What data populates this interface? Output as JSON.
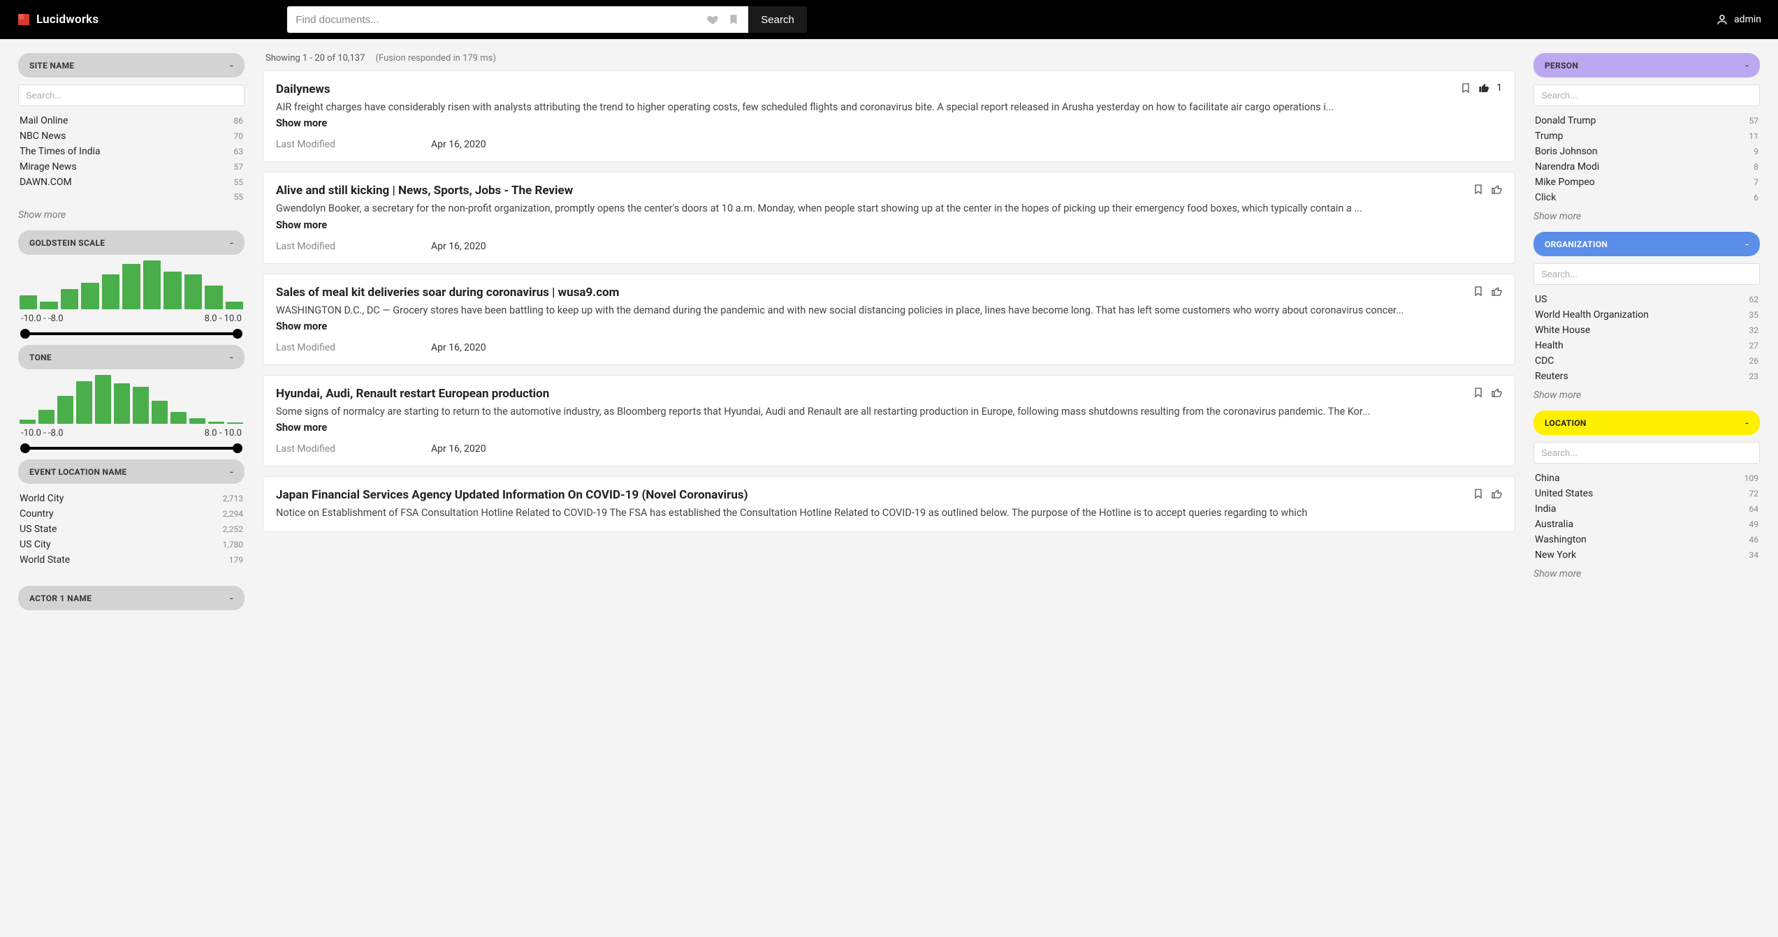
{
  "header": {
    "brand": "Lucidworks",
    "search_placeholder": "Find documents...",
    "search_button": "Search",
    "user": "admin"
  },
  "left": {
    "site_name": {
      "title": "SITE NAME",
      "search_ph": "Search...",
      "items": [
        {
          "label": "Mail Online",
          "count": "86"
        },
        {
          "label": "NBC News",
          "count": "70"
        },
        {
          "label": "The Times of India",
          "count": "63"
        },
        {
          "label": "Mirage News",
          "count": "57"
        },
        {
          "label": "DAWN.COM",
          "count": "55"
        },
        {
          "label": "",
          "count": "55"
        }
      ],
      "show_more": "Show more"
    },
    "goldstein": {
      "title": "GOLDSTEIN SCALE",
      "bars": [
        22,
        12,
        32,
        42,
        56,
        72,
        78,
        60,
        56,
        38,
        12
      ],
      "low": "-10.0 - -8.0",
      "high": "8.0 - 10.0"
    },
    "tone": {
      "title": "TONE",
      "bars": [
        8,
        26,
        52,
        78,
        90,
        74,
        68,
        42,
        22,
        10,
        4,
        2
      ],
      "low": "-10.0 - -8.0",
      "high": "8.0 - 10.0"
    },
    "event_loc": {
      "title": "EVENT LOCATION NAME",
      "items": [
        {
          "label": "World City",
          "count": "2,713"
        },
        {
          "label": "Country",
          "count": "2,294"
        },
        {
          "label": "US State",
          "count": "2,252"
        },
        {
          "label": "US City",
          "count": "1,780"
        },
        {
          "label": "World State",
          "count": "179"
        }
      ]
    },
    "actor1": {
      "title": "ACTOR 1 NAME"
    }
  },
  "results": {
    "meta": "Showing 1 - 20 of 10,137",
    "resp": "(Fusion responded in 179 ms)",
    "show_more_label": "Show more",
    "last_mod_label": "Last Modified",
    "items": [
      {
        "title": "Dailynews",
        "snippet": "AIR freight charges have considerably risen with analysts attributing the trend to higher operating costs, few scheduled flights and coronavirus bite. A special report released in Arusha yesterday on how to facilitate air cargo operations i...",
        "date": "Apr 16, 2020",
        "likes": "1"
      },
      {
        "title": "Alive and still kicking | News, Sports, Jobs - The Review",
        "snippet": "Gwendolyn Booker, a secretary for the non-profit organization, promptly opens the center's doors at 10 a.m. Monday, when people start showing up at the center in the hopes of picking up their emergency food boxes, which typically contain a ...",
        "date": "Apr 16, 2020",
        "likes": ""
      },
      {
        "title": "Sales of meal kit deliveries soar during coronavirus | wusa9.com",
        "snippet": "WASHINGTON D.C., DC — Grocery stores have been battling to keep up with the demand during the pandemic and with new social distancing policies in place, lines have become long. That has left some customers who worry about coronavirus concer...",
        "date": "Apr 16, 2020",
        "likes": ""
      },
      {
        "title": "Hyundai, Audi, Renault restart European production",
        "snippet": "Some signs of normalcy are starting to return to the automotive industry, as Bloomberg reports that Hyundai, Audi and Renault are all restarting production in Europe, following mass shutdowns resulting from the coronavirus pandemic. The Kor...",
        "date": "Apr 16, 2020",
        "likes": ""
      },
      {
        "title": "Japan Financial Services Agency Updated Information On COVID-19 (Novel Coronavirus)",
        "snippet": "Notice on Establishment of FSA Consultation Hotline Related to COVID-19 The FSA has established the Consultation Hotline Related to COVID-19 as outlined below. The purpose of the Hotline is to accept queries regarding to which",
        "date": "",
        "likes": ""
      }
    ]
  },
  "right": {
    "person": {
      "title": "PERSON",
      "search_ph": "Search...",
      "items": [
        {
          "label": "Donald Trump",
          "count": "57"
        },
        {
          "label": "Trump",
          "count": "11"
        },
        {
          "label": "Boris Johnson",
          "count": "9"
        },
        {
          "label": "Narendra Modi",
          "count": "8"
        },
        {
          "label": "Mike Pompeo",
          "count": "7"
        },
        {
          "label": "Click",
          "count": "6"
        }
      ],
      "show_more": "Show more"
    },
    "organization": {
      "title": "ORGANIZATION",
      "search_ph": "Search...",
      "items": [
        {
          "label": "US",
          "count": "62"
        },
        {
          "label": "World Health Organization",
          "count": "35"
        },
        {
          "label": "White House",
          "count": "32"
        },
        {
          "label": "Health",
          "count": "27"
        },
        {
          "label": "CDC",
          "count": "26"
        },
        {
          "label": "Reuters",
          "count": "23"
        }
      ],
      "show_more": "Show more"
    },
    "location": {
      "title": "LOCATION",
      "search_ph": "Search...",
      "items": [
        {
          "label": "China",
          "count": "109"
        },
        {
          "label": "United States",
          "count": "72"
        },
        {
          "label": "India",
          "count": "64"
        },
        {
          "label": "Australia",
          "count": "49"
        },
        {
          "label": "Washington",
          "count": "46"
        },
        {
          "label": "New York",
          "count": "34"
        }
      ],
      "show_more": "Show more"
    }
  },
  "chart_data": [
    {
      "type": "bar",
      "title": "GOLDSTEIN SCALE",
      "xlabel": "",
      "ylabel": "",
      "categories": [
        "-10.0 - -8.0",
        "",
        "",
        "",
        "",
        "",
        "",
        "",
        "",
        "",
        "8.0 - 10.0"
      ],
      "values": [
        22,
        12,
        32,
        42,
        56,
        72,
        78,
        60,
        56,
        38,
        12
      ],
      "xlim_label_low": "-10.0 - -8.0",
      "xlim_label_high": "8.0 - 10.0"
    },
    {
      "type": "bar",
      "title": "TONE",
      "xlabel": "",
      "ylabel": "",
      "categories": [
        "-10.0 - -8.0",
        "",
        "",
        "",
        "",
        "",
        "",
        "",
        "",
        "",
        "",
        "8.0 - 10.0"
      ],
      "values": [
        8,
        26,
        52,
        78,
        90,
        74,
        68,
        42,
        22,
        10,
        4,
        2
      ],
      "xlim_label_low": "-10.0 - -8.0",
      "xlim_label_high": "8.0 - 10.0"
    }
  ]
}
